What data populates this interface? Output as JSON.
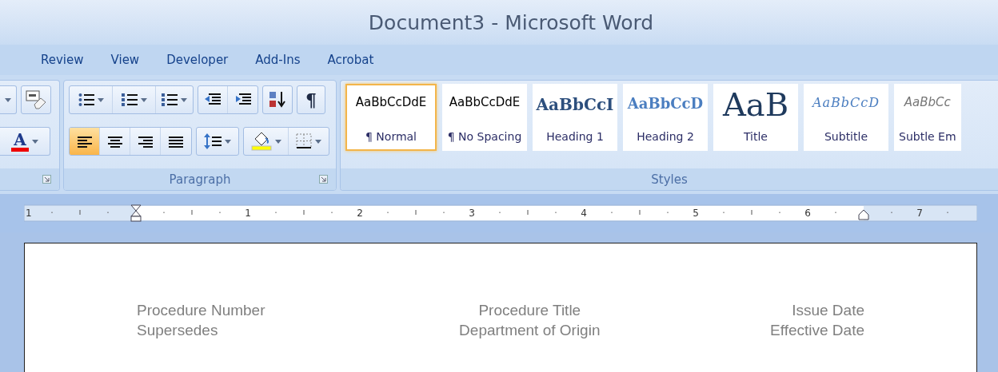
{
  "window": {
    "title": "Document3 - Microsoft Word"
  },
  "tabs": [
    {
      "label": "Review",
      "selected": false
    },
    {
      "label": "View",
      "selected": false
    },
    {
      "label": "Developer",
      "selected": false
    },
    {
      "label": "Add-Ins",
      "selected": false
    },
    {
      "label": "Acrobat",
      "selected": false
    }
  ],
  "font_group": {
    "font_color_glyph": "A"
  },
  "paragraph_group": {
    "label": "Paragraph",
    "show_marks_glyph": "¶",
    "alignment": [
      {
        "kind": "left",
        "selected": true
      },
      {
        "kind": "center",
        "selected": false
      },
      {
        "kind": "right",
        "selected": false
      },
      {
        "kind": "justify",
        "selected": false
      }
    ]
  },
  "styles_group": {
    "label": "Styles",
    "items": [
      {
        "sample": "AaBbCcDdE",
        "label": "¶ Normal",
        "kind": "normal",
        "selected": true
      },
      {
        "sample": "AaBbCcDdE",
        "label": "¶ No Spacing",
        "kind": "normal",
        "selected": false
      },
      {
        "sample": "AaBbCcI",
        "label": "Heading 1",
        "kind": "heading1",
        "selected": false
      },
      {
        "sample": "AaBbCcD",
        "label": "Heading 2",
        "kind": "heading2",
        "selected": false
      },
      {
        "sample": "AaB",
        "label": "Title",
        "kind": "title",
        "selected": false
      },
      {
        "sample": "AaBbCcD",
        "label": "Subtitle",
        "kind": "subtitle",
        "selected": false
      },
      {
        "sample": "AaBbCc",
        "label": "Subtle Em",
        "kind": "subtle",
        "selected": false
      }
    ]
  },
  "ruler": {
    "labels": [
      "1",
      "1",
      "2",
      "3",
      "4",
      "5",
      "6",
      "7"
    ]
  },
  "document": {
    "header_columns": [
      {
        "lines": [
          "Procedure Number",
          "Supersedes"
        ]
      },
      {
        "lines": [
          "Procedure Title",
          "Department of Origin"
        ]
      },
      {
        "lines": [
          "Issue Date",
          "Effective Date"
        ]
      }
    ]
  }
}
